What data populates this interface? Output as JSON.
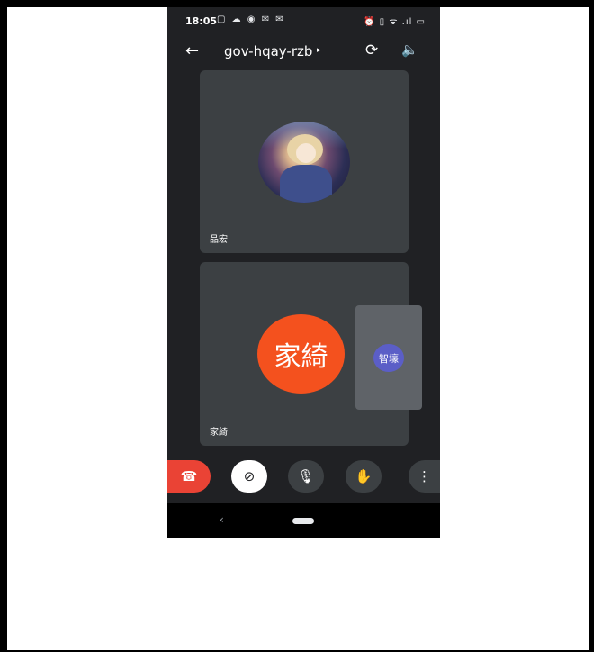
{
  "status_bar": {
    "time": "18:05",
    "left_icons": "▢ ☁ ◉ ✉ ✉",
    "right_icons": "⏰ ▯ ᯤ .ıl ▭"
  },
  "app_bar": {
    "back_icon": "←",
    "meeting_code": "gov-hqay-rzb",
    "caret": "▸",
    "switch_camera_icon": "⟳",
    "speaker_icon": "🔈"
  },
  "participants": [
    {
      "name": "品宏",
      "avatar": "photo"
    },
    {
      "name": "家綺",
      "avatar_text": "家綺",
      "avatar_color": "#f4511e"
    }
  ],
  "self_view": {
    "avatar_text": "智壕",
    "avatar_color": "#5b5ec7"
  },
  "controls": {
    "hangup_icon": "☎",
    "video_off_icon": "⊘",
    "mic_icon": "🎙",
    "raise_hand_icon": "✋",
    "more_icon": "⋮"
  },
  "nav": {
    "back_icon": "‹"
  }
}
